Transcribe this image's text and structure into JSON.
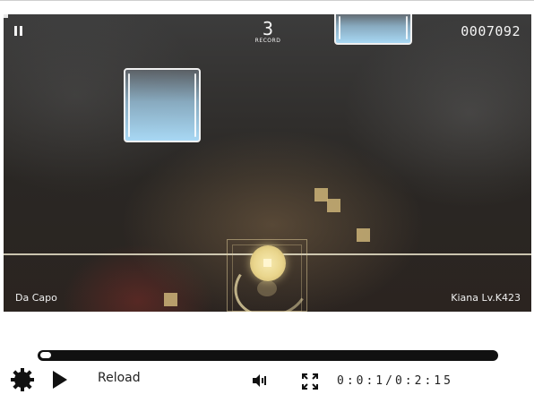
{
  "hud": {
    "combo": "3",
    "combo_label": "RECORD",
    "score": "0007092",
    "song_name": "Da Capo",
    "player_level": "Kiana  Lv.K423"
  },
  "controls": {
    "reload_label": "Reload",
    "time": "0:0:1/0:2:15",
    "progress": 0.01
  },
  "colors": {
    "note_fill": "#a8d8f4",
    "hit_effect": "#e9d58c",
    "judge_line": "#e6e1c8",
    "progress_track": "#111111"
  },
  "icons": [
    "pause-icon",
    "gear-icon",
    "play-icon",
    "volume-icon",
    "fullscreen-icon"
  ]
}
